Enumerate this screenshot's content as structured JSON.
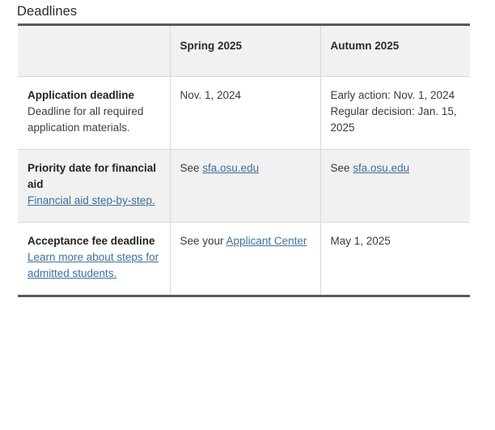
{
  "page": {
    "title": "Deadlines"
  },
  "table": {
    "columns": [
      {
        "key": "label",
        "header": ""
      },
      {
        "key": "spring",
        "header": "Spring 2025"
      },
      {
        "key": "autumn",
        "header": "Autumn 2025"
      }
    ],
    "rows": [
      {
        "label_title": "Application deadline",
        "label_desc": "Deadline for all required application materials.",
        "label_link": "",
        "spring_lines": [
          "Nov. 1, 2024"
        ],
        "spring_prefix": "",
        "spring_link": "",
        "autumn_lines": [
          "Early action: Nov. 1, 2024",
          "Regular decision: Jan. 15, 2025"
        ],
        "autumn_prefix": "",
        "autumn_link": "",
        "shaded": false
      },
      {
        "label_title": "Priority date for financial aid",
        "label_desc": "",
        "label_link": "Financial aid step-by-step.",
        "spring_lines": [],
        "spring_prefix": "See ",
        "spring_link": "sfa.osu.edu",
        "autumn_lines": [],
        "autumn_prefix": "See ",
        "autumn_link": "sfa.osu.edu",
        "shaded": true
      },
      {
        "label_title": "Acceptance fee deadline",
        "label_desc": "",
        "label_link": "Learn more about steps for admitted students.",
        "spring_lines": [],
        "spring_prefix": "See your ",
        "spring_link": "Applicant Center",
        "autumn_lines": [
          "May 1, 2025"
        ],
        "autumn_prefix": "",
        "autumn_link": "",
        "shaded": false
      }
    ]
  },
  "colors": {
    "link": "#3d6f9e",
    "rule": "#5a5a5a",
    "cell_border": "#d8d8d8",
    "shaded_row": "#f1f1f1",
    "text": "#2f2f2f"
  }
}
